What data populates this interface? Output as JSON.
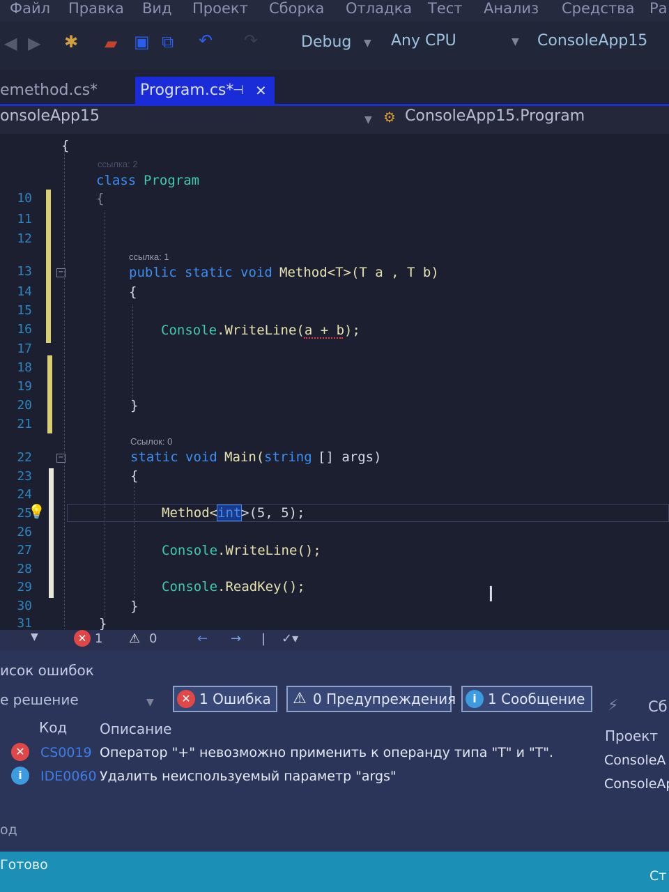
{
  "menu": [
    "Файл",
    "Правка",
    "Вид",
    "Проект",
    "Сборка",
    "Отладка",
    "Тест",
    "Анализ",
    "Средства",
    "Ра"
  ],
  "toolbar": {
    "config": "Debug",
    "platform": "Any CPU",
    "startup_project": "ConsoleApp15"
  },
  "tabs": {
    "inactive": "emethod.cs*",
    "active": "Program.cs*",
    "pin_glyph": "⊣",
    "close_glyph": "✕"
  },
  "navbar": {
    "project": "onsoleApp15",
    "class": "ConsoleApp15.Program"
  },
  "editor": {
    "codelens_class": "ссылка: 2",
    "codelens_method": "ссылка: 1",
    "codelens_main": "Ссылок: 0",
    "line_numbers": [
      "10",
      "11",
      "12",
      "13",
      "14",
      "15",
      "16",
      "17",
      "18",
      "19",
      "20",
      "21",
      "22",
      "23",
      "24",
      "25",
      "26",
      "27",
      "28",
      "29",
      "30",
      "31"
    ],
    "lines": {
      "brace_ns": "{",
      "class_kw": "class",
      "class_name": "Program",
      "brace_class": "{",
      "m_public": "public",
      "m_static": "static",
      "m_void": "void",
      "m_name": "Method<T>(T a , T b)",
      "m_open": "{",
      "cw_console": "Console",
      "cw_call": ".WriteLine(a + b);",
      "m_close": "}",
      "main_static": "static",
      "main_void": "void",
      "main_name": "Main(",
      "main_string": "string",
      "main_args": "[] args)",
      "main_open": "{",
      "call_method": "Method<",
      "call_int": "int",
      "call_rest": ">(5, 5);",
      "c2_console": "Console",
      "c2_call": ".WriteLine();",
      "c3_console": "Console",
      "c3_call": ".ReadKey();",
      "main_close": "}",
      "class_close": "}"
    }
  },
  "strip": {
    "errors": "1",
    "warnings": "0"
  },
  "error_list": {
    "title": "исок ошибок",
    "scope": "е решение",
    "filter_errors": "1 Ошибка",
    "filter_warnings": "0 Предупреждения",
    "filter_messages": "1 Сообщение",
    "cut_label": "Сб",
    "columns": {
      "code": "Код",
      "description": "Описание",
      "project": "Проект"
    },
    "rows": [
      {
        "code": "CS0019",
        "description": "Оператор \"+\" невозможно применить к операнду типа \"T\" и \"T\".",
        "project": "ConsoleA"
      },
      {
        "code": "IDE0060",
        "description": "Удалить неиспользуемый параметр \"args\"",
        "project": "ConsoleAp"
      }
    ]
  },
  "bottom_tab": "од",
  "status": {
    "left": "Готово",
    "right": "Ст"
  },
  "colors": {
    "accent": "#1a2bd8",
    "status_bar": "#1b8fb5",
    "error": "#e05555",
    "info": "#3d9be0"
  }
}
